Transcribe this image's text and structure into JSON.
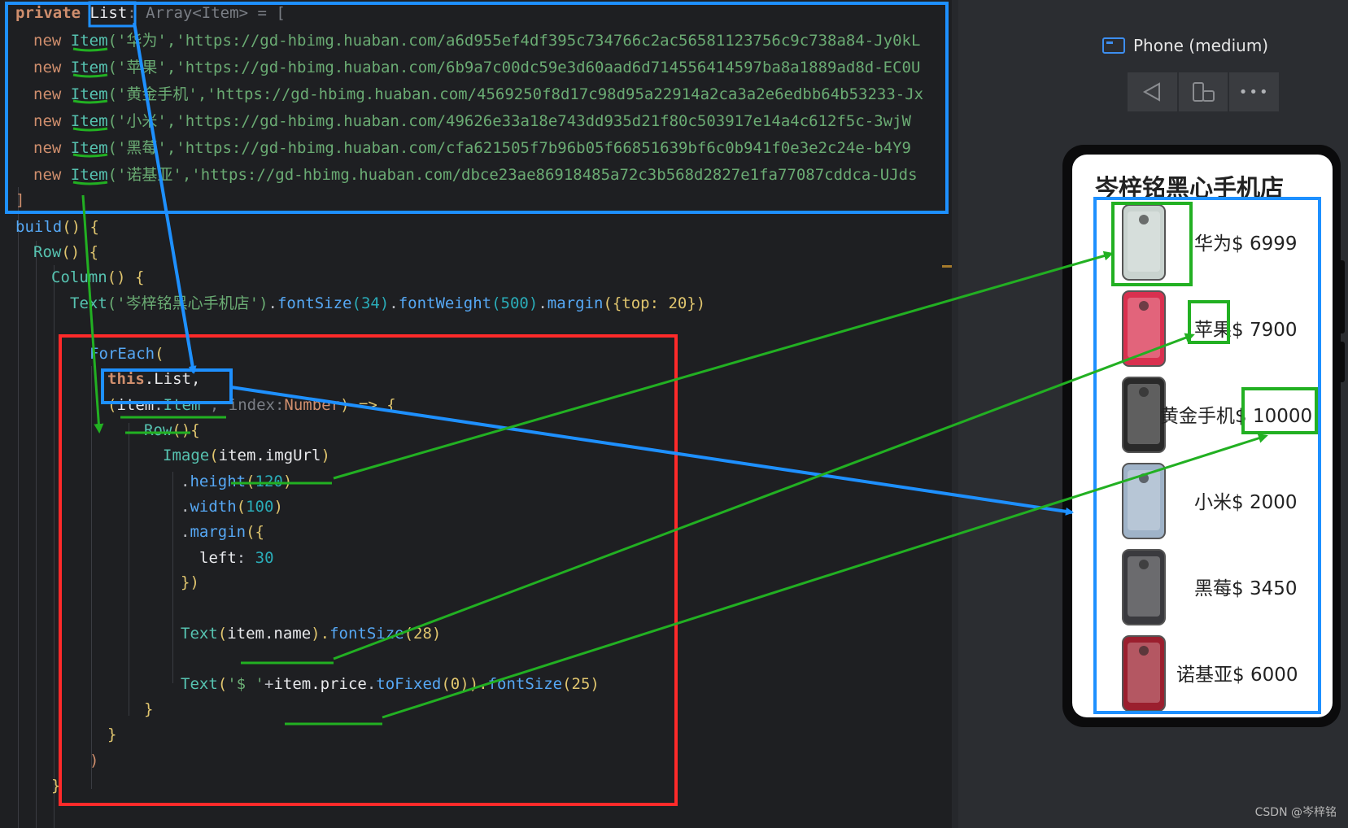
{
  "code": {
    "line1": {
      "kw": "private",
      "sp": " ",
      "var": "List",
      "rest": ": Array<Item> = ["
    },
    "items": [
      {
        "kw": "new",
        "cls": "Item",
        "str": "('华为','https://gd-hbimg.huaban.com/a6d955ef4df395c734766c2ac56581123756c9c738a84-Jy0kL"
      },
      {
        "kw": "new",
        "cls": "Item",
        "str": "('苹果','https://gd-hbimg.huaban.com/6b9a7c00dc59e3d60aad6d714556414597ba8a1889ad8d-EC0U"
      },
      {
        "kw": "new",
        "cls": "Item",
        "str": "('黄金手机','https://gd-hbimg.huaban.com/4569250f8d17c98d95a22914a2ca3a2e6edbb64b53233-Jx"
      },
      {
        "kw": "new",
        "cls": "Item",
        "str": "('小米','https://gd-hbimg.huaban.com/49626e33a18e743dd935d21f80c503917e14a4c612f5c-3wjW"
      },
      {
        "kw": "new",
        "cls": "Item",
        "str": "('黑莓','https://gd-hbimg.huaban.com/cfa621505f7b96b05f66851639bf6c0b941f0e3e2c24e-b4Y9"
      },
      {
        "kw": "new",
        "cls": "Item",
        "str": "('诺基亚','https://gd-hbimg.huaban.com/dbce23ae86918485a72c3b568d2827e1fa77087cddca-UJds"
      }
    ],
    "close_bracket": "]",
    "build": {
      "name": "build",
      "rest": "() {"
    },
    "row": {
      "name": "Row",
      "rest": "() {"
    },
    "column": {
      "name": "Column",
      "rest": "() {"
    },
    "text_title": {
      "fn": "Text",
      "arg": "('岑梓铭黑心手机店')",
      "dot1": ".",
      "m1": "fontSize",
      "a1": "(34)",
      "dot2": ".",
      "m2": "fontWeight",
      "a2": "(500)",
      "dot3": ".",
      "m3": "margin",
      "a3": "({top: 20})"
    },
    "foreach": {
      "name": "ForEach",
      "rest": "("
    },
    "this_list": {
      "kw": "this",
      "rest": ".List,"
    },
    "lambda": {
      "open": "(",
      "item": "item",
      "colon": ":",
      "type": "Item",
      "sep": " , ",
      "index": "index",
      "colon2": ":",
      "type2": "Number",
      "close": ") => {"
    },
    "row2": {
      "name": "Row",
      "rest": "(){"
    },
    "image": {
      "fn": "Image",
      "open": "(",
      "arg": "item.imgUrl",
      "close": ")"
    },
    "height": {
      "dot": ".",
      "m": "height",
      "open": "(",
      "num": "120",
      "close": ")"
    },
    "width": {
      "dot": ".",
      "m": "width",
      "open": "(",
      "num": "100",
      "close": ")"
    },
    "margin": {
      "dot": ".",
      "m": "margin",
      "rest": "({"
    },
    "left": {
      "key": "left",
      "colon": ": ",
      "num": "30"
    },
    "close_obj": "})",
    "text_name": {
      "fn": "Text",
      "open": "(",
      "arg": "item.name",
      "close": ").",
      "m": "fontSize",
      "a": "(28)"
    },
    "text_price": {
      "fn": "Text",
      "open": "(",
      "str": "'$ '",
      "plus": "+",
      "arg": "item.price",
      "dot": ".",
      "m": "toFixed",
      "a": "(0)",
      "close": ").",
      "m2": "fontSize",
      "a2": "(25)"
    },
    "brace1": "}",
    "brace2": "}",
    "paren": ")",
    "brace3": "}"
  },
  "preview": {
    "device_label": "Phone (medium)",
    "toolbar": {
      "back_icon": "back-triangle-icon",
      "rotate_icon": "rotate-device-icon",
      "more_icon": "more-dots-icon",
      "more_text": "•••"
    },
    "app": {
      "title": "岑梓铭黑心手机店",
      "products": [
        {
          "name": "华为",
          "price": "$ 6999",
          "color": "#c9d3cf"
        },
        {
          "name": "苹果",
          "price": "$ 7900",
          "color": "#d9304f"
        },
        {
          "name": "黄金手机",
          "price": "$ 10000",
          "color": "#2a2a2a"
        },
        {
          "name": "小米",
          "price": "$ 2000",
          "color": "#9fb3c8"
        },
        {
          "name": "黑莓",
          "price": "$ 3450",
          "color": "#3a3a3e"
        },
        {
          "name": "诺基亚",
          "price": "$ 6000",
          "color": "#9b1f2e"
        }
      ]
    }
  },
  "colors": {
    "blue_box": "#1e90ff",
    "red_box": "#ff2a2a",
    "green_box": "#22b022"
  },
  "watermark": "CSDN @岑梓铭"
}
